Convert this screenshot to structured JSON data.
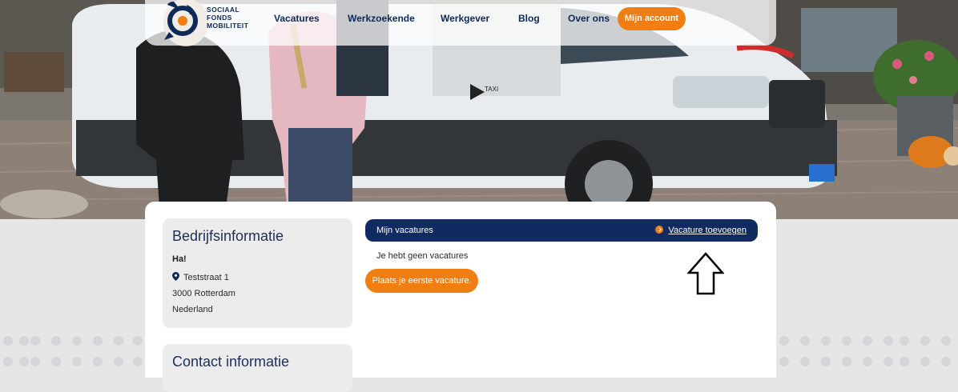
{
  "brand": {
    "line1": "SOCIAAL",
    "line2": "FONDS",
    "line3": "MOBILITEIT"
  },
  "nav": {
    "items": [
      "Vacatures",
      "Werkzoekende",
      "Werkgever",
      "Blog",
      "Over ons"
    ],
    "account": "Mijn account"
  },
  "hero": {
    "van_sign": "TAXI"
  },
  "company": {
    "heading": "Bedrijfsinformatie",
    "name": "Ha!",
    "street": "Teststraat 1",
    "city": "3000 Rotterdam",
    "country": "Nederland"
  },
  "contact": {
    "heading": "Contact informatie"
  },
  "vacatures": {
    "title": "Mijn vacatures",
    "add_link": "Vacature toevoegen",
    "empty": "Je hebt geen vacatures",
    "first_button": "Plaats je eerste vacature."
  },
  "colors": {
    "navy": "#0f2b5f",
    "orange": "#f07e13"
  },
  "icons": [
    "logo-icon",
    "location-pin-icon",
    "arrow-right-icon",
    "up-arrow-icon"
  ]
}
